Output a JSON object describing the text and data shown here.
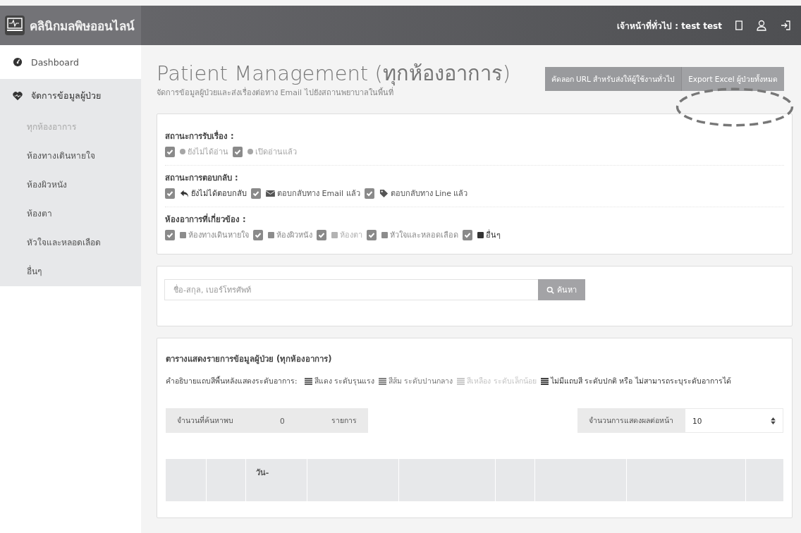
{
  "brand": {
    "name": "คลินิกมลพิษออนไลน์"
  },
  "header": {
    "user": "เจ้าหน้าที่ทั่วไป : test test"
  },
  "sidebar": {
    "items": [
      {
        "label": "Dashboard"
      },
      {
        "label": "จัดการข้อมูลผู้ป่วย",
        "children": [
          {
            "label": "ทุกห้องอาการ",
            "selected": true
          },
          {
            "label": "ห้องทางเดินหายใจ",
            "selected": false
          },
          {
            "label": "ห้องผิวหนัง",
            "selected": false
          },
          {
            "label": "ห้องตา",
            "selected": false
          },
          {
            "label": "หัวใจและหลอดเลือด",
            "selected": false
          },
          {
            "label": "อื่นๆ",
            "selected": false
          }
        ]
      }
    ]
  },
  "page": {
    "title": "Patient Management (ทุกห้องอาการ)",
    "subtitle": "จัดการข้อมูลผู้ป่วยและส่งเรื่องต่อทาง Email ไปยังสถานพยาบาลในพื้นที่",
    "buttons": [
      "คัดลอก URL สำหรับส่งให้ผู้ใช้งานทั่วไป",
      "Export Excel ผู้ป่วยทั้งหมด"
    ]
  },
  "filters": [
    {
      "label": "สถานะการรับเรื่อง :",
      "options": [
        {
          "label": "ยังไม่ได้อ่าน",
          "checked": true,
          "kind": "dot",
          "color": "#a6a6a6"
        },
        {
          "label": "เปิดอ่านแล้ว",
          "checked": true,
          "kind": "dot",
          "color": "#a6a6a6"
        }
      ]
    },
    {
      "label": "สถานะการตอบกลับ :",
      "options": [
        {
          "label": "ยังไม่ได้ตอบกลับ",
          "checked": true,
          "kind": "reply",
          "color": "#333333"
        },
        {
          "label": "ตอบกลับทาง Email แล้ว",
          "checked": true,
          "kind": "mail",
          "color": "#555555"
        },
        {
          "label": "ตอบกลับทาง Line แล้ว",
          "checked": true,
          "kind": "tag",
          "color": "#555555"
        }
      ]
    },
    {
      "label": "ห้องอาการที่เกี่ยวข้อง :",
      "options": [
        {
          "label": "ห้องทางเดินหายใจ",
          "checked": true,
          "kind": "square",
          "color": "#8c8c8c"
        },
        {
          "label": "ห้องผิวหนัง",
          "checked": true,
          "kind": "square",
          "color": "#8c8c8c"
        },
        {
          "label": "ห้องตา",
          "checked": true,
          "kind": "square",
          "color": "#b3b3b3"
        },
        {
          "label": "หัวใจและหลอดเลือด",
          "checked": true,
          "kind": "square",
          "color": "#8c8c8c"
        },
        {
          "label": "อื่นๆ",
          "checked": true,
          "kind": "square",
          "color": "#333333"
        }
      ]
    }
  ],
  "search": {
    "placeholder": "ชื่อ-สกุล, เบอร์โทรศัพท์",
    "button": "ค้นหา"
  },
  "table": {
    "title": "ตารางแสดงรายการข้อมูลผู้ป่วย (ทุกห้องอาการ)",
    "legend_label": "คำอธิบายแถบสีพื้นหลังแสดงระดับอาการ:",
    "legend": [
      {
        "label": "สีแดง ระดับรุนแรง",
        "color": "#555555"
      },
      {
        "label": "สีส้ม ระดับปานกลาง",
        "color": "#777777"
      },
      {
        "label": "สีเหลือง ระดับเล็กน้อย",
        "color": "#c4c4c4"
      },
      {
        "label": "ไม่มีแถบสี ระดับปกติ หรือ ไม่สามารถระบุระดับอาการได้",
        "color": "#333333"
      }
    ],
    "found": {
      "label": "จำนวนที่ค้นหาพบ",
      "value": "0",
      "unit": "รายการ"
    },
    "per_page": {
      "label": "จำนวนการแสดงผลต่อหน้า",
      "value": "10"
    },
    "column_3": "วัน-"
  }
}
